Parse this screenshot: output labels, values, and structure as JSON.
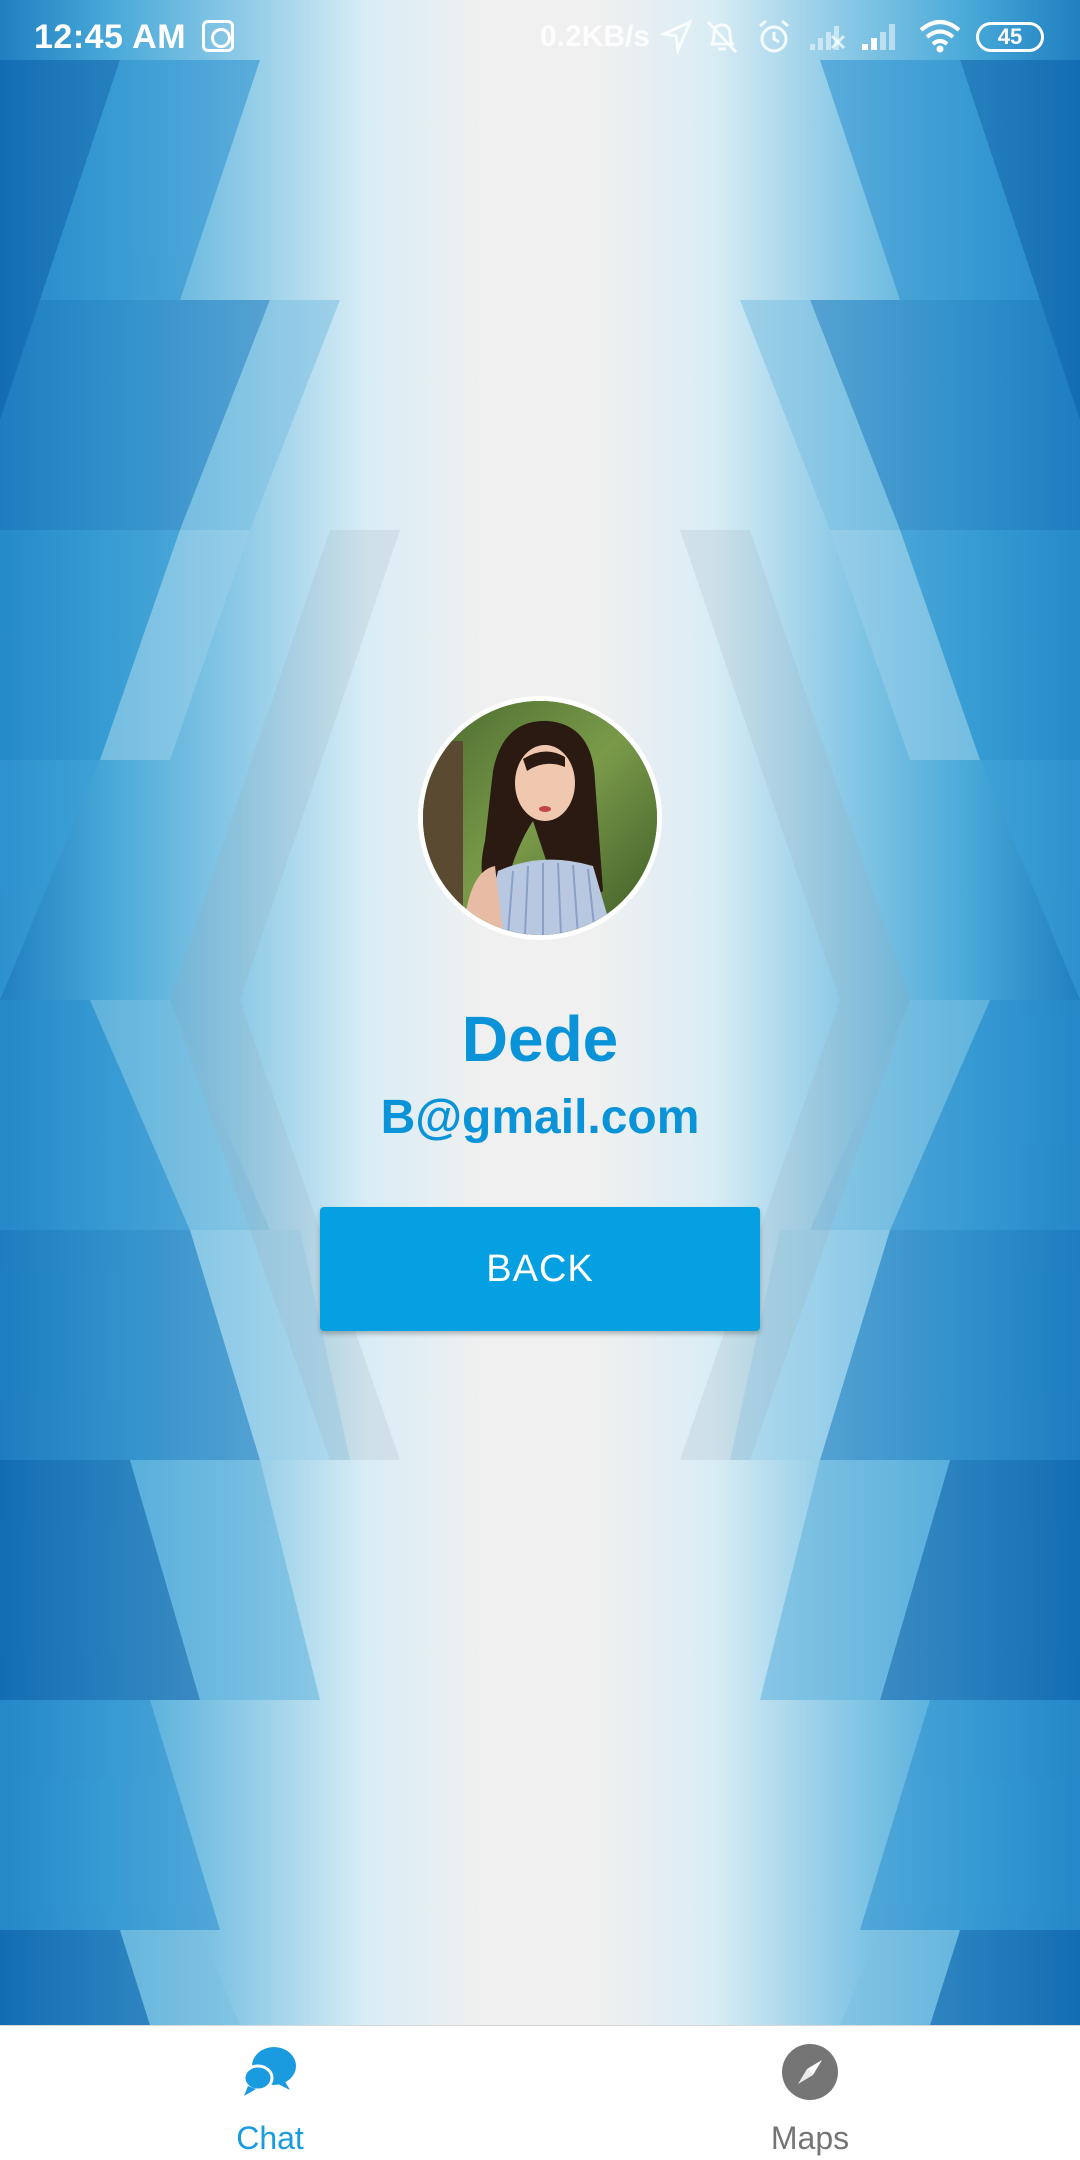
{
  "status_bar": {
    "time": "12:45 AM",
    "network_speed": "0.2KB/s",
    "battery": "45",
    "icons": [
      "app-notification-icon",
      "location-arrow-icon",
      "muted-bell-icon",
      "alarm-icon",
      "signal-icon",
      "signal-icon",
      "wifi-icon",
      "battery-icon"
    ]
  },
  "profile": {
    "avatar_icon": "profile-photo",
    "name": "Dede",
    "email": "B@gmail.com"
  },
  "actions": {
    "back_label": "BACK"
  },
  "bottom_nav": {
    "items": [
      {
        "label": "Chat",
        "icon": "chat-bubbles-icon",
        "active": true
      },
      {
        "label": "Maps",
        "icon": "compass-icon",
        "active": false
      }
    ]
  },
  "colors": {
    "accent": "#05a0e2",
    "text_accent": "#0a93d8",
    "nav_active": "#1a9be0",
    "nav_inactive": "#757575"
  }
}
